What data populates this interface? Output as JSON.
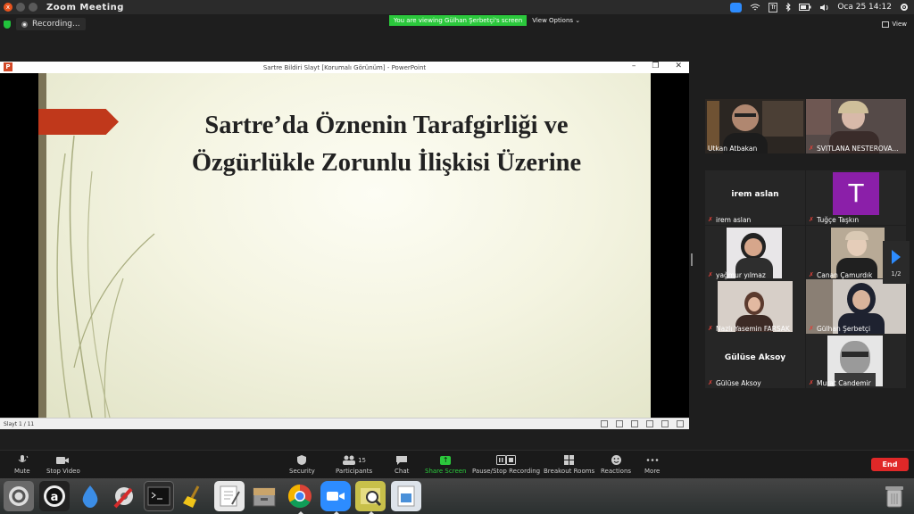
{
  "system": {
    "app_title": "Zoom Meeting",
    "datetime": "Oca 25 14:12",
    "keyboard_layout": "Tr",
    "window_close_glyph": "x"
  },
  "zoom": {
    "recording_label": "Recording...",
    "viewing_banner": "You are viewing Gülhan Şerbetçi's screen",
    "view_options": "View Options",
    "view_button": "View",
    "pager": "1/2",
    "participant_count": "15",
    "end_label": "End",
    "controls": [
      "Mute",
      "Stop Video",
      "Security",
      "Participants",
      "Chat",
      "Share Screen",
      "Pause/Stop Recording",
      "Breakout Rooms",
      "Reactions",
      "More"
    ]
  },
  "ppt": {
    "window_title": "Sartre Bildiri Slayt [Korumalı Görünüm] - PowerPoint",
    "logo_letter": "P",
    "slide_title_line1": "Sartre’da Öznenin Tarafgirliği ve",
    "slide_title_line2": "Özgürlükle Zorunlu İlişkisi Üzerine",
    "status": "Slayt 1 / 11"
  },
  "participants": [
    {
      "name": "Utkan Atbakan",
      "type": "video",
      "muted": false
    },
    {
      "name": "SVITLANA NESTEROVA...",
      "type": "video",
      "muted": true
    },
    {
      "name": "irem aslan",
      "type": "name",
      "display": "irem aslan",
      "muted": true
    },
    {
      "name": "Tuğçe Taşkın",
      "type": "avatar",
      "letter": "T",
      "muted": true
    },
    {
      "name": "yağmur yılmaz",
      "type": "video",
      "muted": true
    },
    {
      "name": "Canan Çamurdık",
      "type": "video",
      "muted": true
    },
    {
      "name": "Nazlı Yasemin FARSAK",
      "type": "video",
      "muted": true
    },
    {
      "name": "Gülhan Şerbetçi",
      "type": "video",
      "muted": true
    },
    {
      "name": "Gülüse Aksoy",
      "type": "name",
      "display": "Gülüse Aksoy",
      "muted": true
    },
    {
      "name": "Murat Candemir",
      "type": "video",
      "muted": true
    }
  ],
  "colors": {
    "zoom_blue": "#2d8cff",
    "share_green": "#2bc83c",
    "end_red": "#e02828",
    "slide_arrow": "#c0381b",
    "avatar_purple": "#8b1fa9"
  }
}
